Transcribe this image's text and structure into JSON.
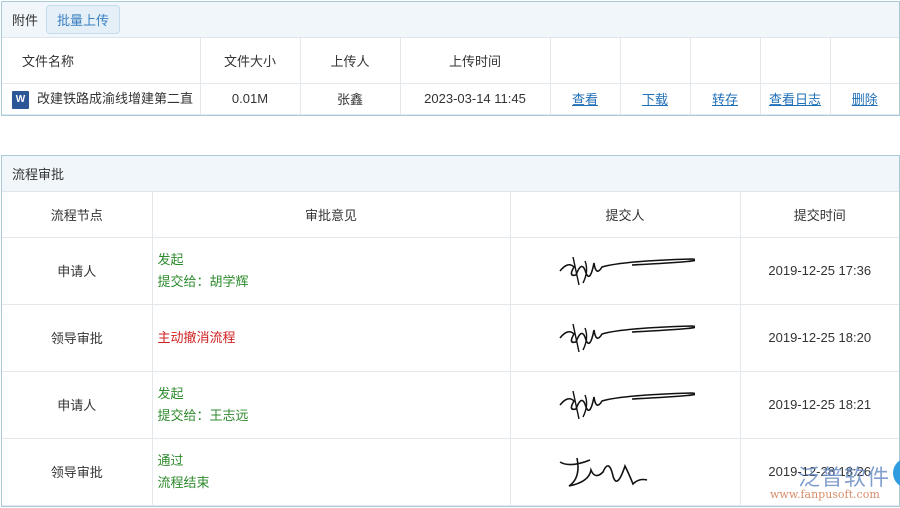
{
  "attachments": {
    "title": "附件",
    "batch_upload": "批量上传",
    "headers": [
      "文件名称",
      "文件大小",
      "上传人",
      "上传时间",
      "",
      "",
      "",
      "",
      ""
    ],
    "rows": [
      {
        "name": "改建铁路成渝线增建第二直",
        "size": "0.01M",
        "uploader": "张鑫",
        "time": "2023-03-14 11:45",
        "actions": [
          "查看",
          "下载",
          "转存",
          "查看日志",
          "删除"
        ]
      }
    ]
  },
  "workflow": {
    "title": "流程审批",
    "headers": [
      "流程节点",
      "审批意见",
      "提交人",
      "提交时间"
    ],
    "rows": [
      {
        "node": "申请人",
        "opinion": [
          "发起",
          "提交给：胡学辉"
        ],
        "color": "#2e8b2e",
        "time": "2019-12-25 17:36"
      },
      {
        "node": "领导审批",
        "opinion": [
          "主动撤消流程"
        ],
        "color": "#d02020",
        "time": "2019-12-25 18:20"
      },
      {
        "node": "申请人",
        "opinion": [
          "发起",
          "提交给：王志远"
        ],
        "color": "#2e8b2e",
        "time": "2019-12-25 18:21"
      },
      {
        "node": "领导审批",
        "opinion": [
          "通过",
          "流程结束"
        ],
        "color": "#2e8b2e",
        "time": "2019-12-28 18:26"
      }
    ]
  },
  "watermark": {
    "name": "泛普软件",
    "url": "www.fanpusoft.com"
  }
}
